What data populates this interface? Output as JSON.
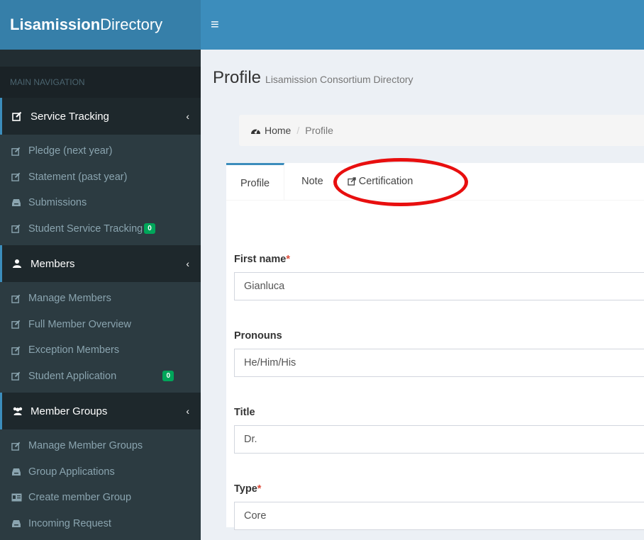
{
  "brand": {
    "bold": "Lisamission",
    "regular": "Directory"
  },
  "sidebar": {
    "header": "MAIN NAVIGATION",
    "sections": [
      {
        "label": "Service Tracking",
        "icon": "edit-icon",
        "items": [
          {
            "label": "Pledge (next year)",
            "icon": "edit-icon"
          },
          {
            "label": "Statement (past year)",
            "icon": "edit-icon"
          },
          {
            "label": "Submissions",
            "icon": "inbox-icon"
          },
          {
            "label": "Student Service Tracking",
            "icon": "edit-icon",
            "badge": "0"
          }
        ]
      },
      {
        "label": "Members",
        "icon": "user-icon",
        "items": [
          {
            "label": "Manage Members",
            "icon": "edit-icon"
          },
          {
            "label": "Full Member Overview",
            "icon": "edit-icon"
          },
          {
            "label": "Exception Members",
            "icon": "edit-icon"
          },
          {
            "label": "Student Application",
            "icon": "edit-icon",
            "badge": "0"
          }
        ]
      },
      {
        "label": "Member Groups",
        "icon": "users-icon",
        "items": [
          {
            "label": "Manage Member Groups",
            "icon": "edit-icon"
          },
          {
            "label": "Group Applications",
            "icon": "inbox-icon"
          },
          {
            "label": "Create member Group",
            "icon": "id-card-icon"
          },
          {
            "label": "Incoming Request",
            "icon": "inbox-icon"
          }
        ]
      }
    ]
  },
  "page": {
    "title": "Profile",
    "subtitle": "Lisamission Consortium Directory"
  },
  "breadcrumb": {
    "home": "Home",
    "current": "Profile"
  },
  "tabs": [
    {
      "label": "Profile",
      "active": true
    },
    {
      "label": "Note"
    },
    {
      "label": "Certification",
      "icon": "external-link-icon"
    }
  ],
  "form": {
    "fields": [
      {
        "label": "First name",
        "required": true,
        "value": "Gianluca"
      },
      {
        "label": "Pronouns",
        "required": false,
        "value": "He/Him/His"
      },
      {
        "label": "Title",
        "required": false,
        "value": "Dr."
      },
      {
        "label": "Type",
        "required": true,
        "value": "Core"
      }
    ]
  },
  "colors": {
    "accent": "#3c8dbc",
    "sidebar": "#222d32",
    "badge": "#00a65a",
    "annotation": "#e80f0f"
  }
}
